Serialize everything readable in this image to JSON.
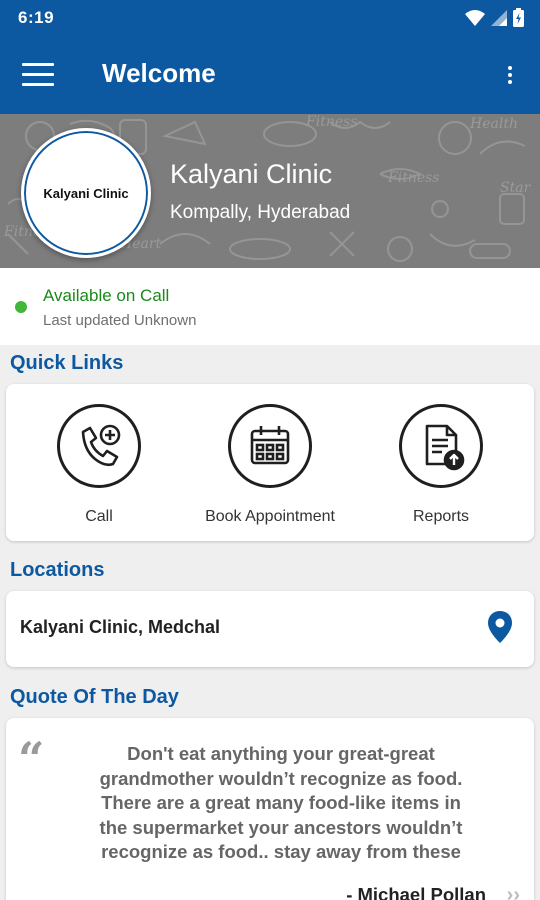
{
  "status_bar": {
    "time": "6:19",
    "icons": [
      "wifi-icon",
      "signal-icon",
      "battery-icon"
    ]
  },
  "app_bar": {
    "title": "Welcome",
    "menu_icon": "hamburger-menu-icon",
    "overflow_icon": "more-vert-icon"
  },
  "hero": {
    "logo_text": "Kalyani Clinic",
    "name": "Kalyani Clinic",
    "location": "Kompally, Hyderabad"
  },
  "availability": {
    "status": "Available on Call",
    "updated": "Last updated Unknown",
    "status_color": "#43b73b"
  },
  "quick_links": {
    "title": "Quick Links",
    "items": [
      {
        "label": "Call",
        "icon": "phone-add-icon"
      },
      {
        "label": "Book Appointment",
        "icon": "calendar-icon"
      },
      {
        "label": "Reports",
        "icon": "report-upload-icon"
      }
    ]
  },
  "locations": {
    "title": "Locations",
    "items": [
      {
        "name": "Kalyani  Clinic, Medchal",
        "icon": "location-pin-icon"
      }
    ]
  },
  "quote": {
    "title": "Quote Of The Day",
    "lines": [
      "Don't eat anything your great-great",
      "grandmother wouldn’t recognize as food.",
      "There are a great many food-like items in",
      "the supermarket your ancestors wouldn’t",
      "recognize as food.. stay away from these"
    ],
    "author": "- Michael Pollan",
    "next_icon": "double-chevron-right-icon"
  },
  "colors": {
    "primary": "#0d59a1",
    "hero_bg": "#7d7d7d",
    "background": "#efefef"
  }
}
